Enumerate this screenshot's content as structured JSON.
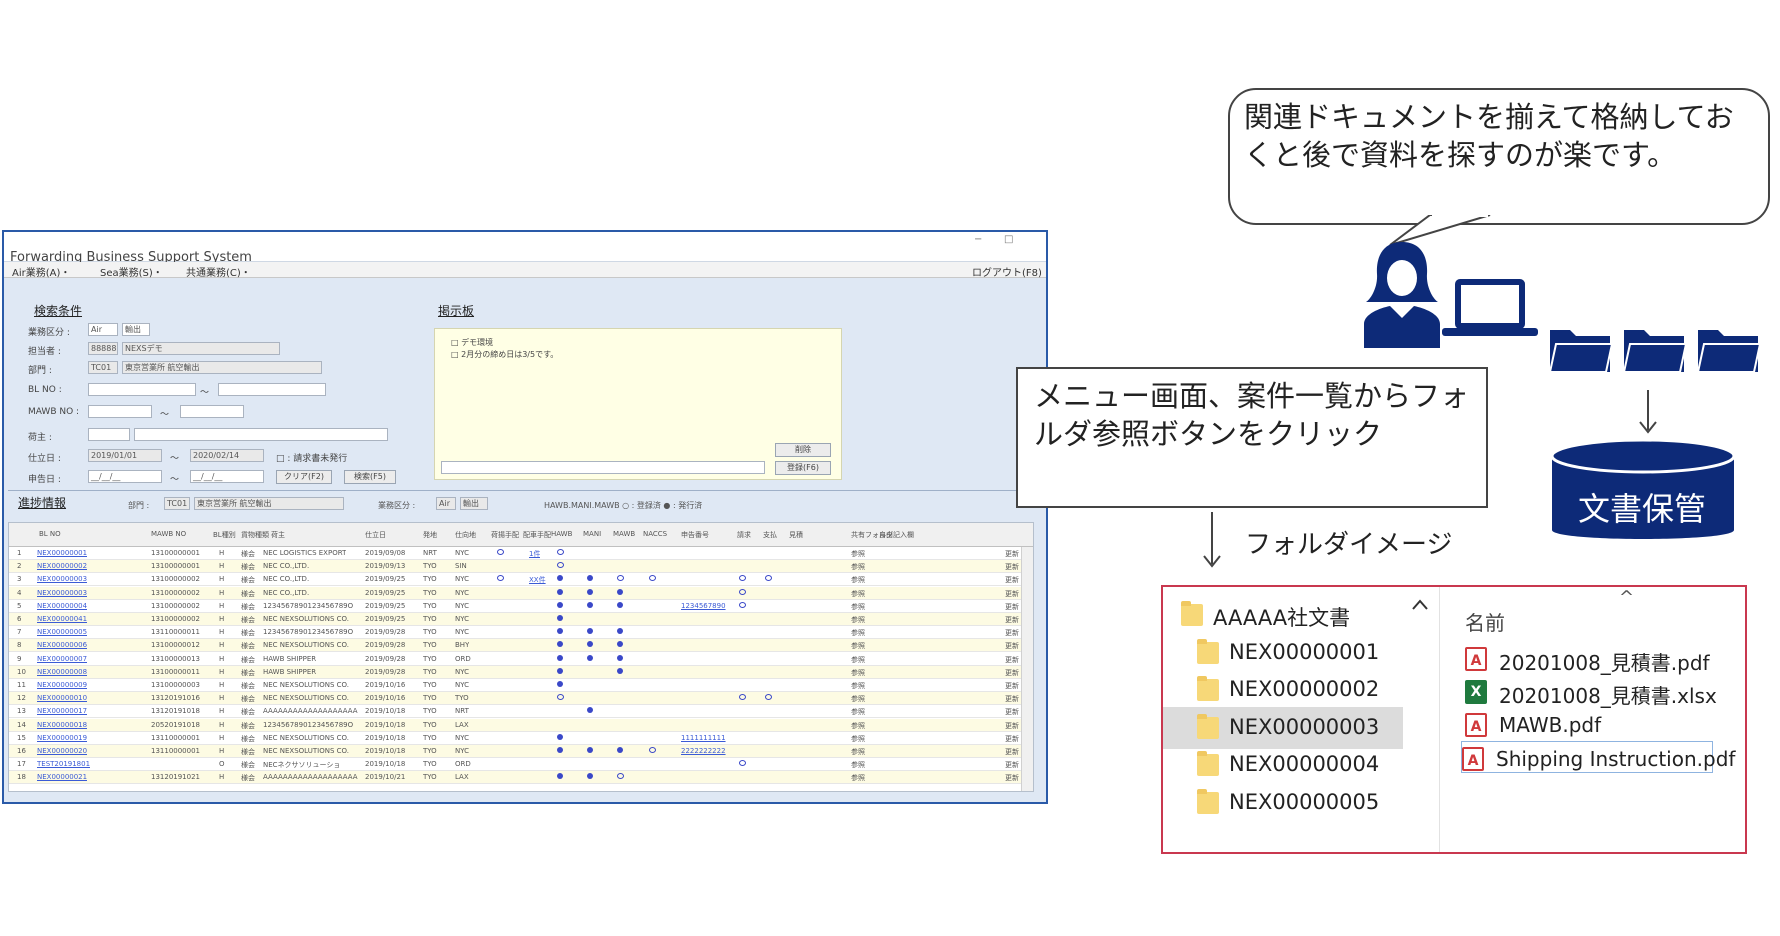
{
  "window": {
    "title": "Forwarding Business Support System",
    "controls": [
      "−",
      "□"
    ],
    "menu": [
      "Air業務(A)・",
      "Sea業務(S)・",
      "共通業務(C)・"
    ],
    "logout": "ログアウト(F8)"
  },
  "search": {
    "section_title": "検索条件",
    "labels": [
      "業務区分 :",
      "担当者  :",
      "部門   :",
      "BL NO  :",
      "MAWB NO :",
      "荷主   :",
      "仕立日  :",
      "申告日  :"
    ],
    "business_type": "Air",
    "business_sub": "輸出",
    "staff_code": "88888",
    "staff_name": "NEXSデモ",
    "dept_code": "TC01",
    "dept_name": "東京営業所 航空輸出",
    "date_from": "2019/01/01",
    "date_to": "2020/02/14",
    "unbilled_label": "□ : 請求書未発行",
    "blank_date": "__/__/__",
    "tilde": "～",
    "clear_button": "クリア(F2)",
    "search_button": "検索(F5)"
  },
  "board": {
    "section_title": "掲示板",
    "lines": [
      "□ デモ環境",
      "□ 2月分の締め日は3/5です。"
    ],
    "delete_button": "削除",
    "register_button": "登録(F6)"
  },
  "progress": {
    "section_title": "進捗情報",
    "dept_label": "部門 :",
    "dept_code": "TC01",
    "dept_name": "東京営業所 航空輸出",
    "biz_label": "業務区分 :",
    "biz_value": "Air",
    "biz_sub": "輸出",
    "legend": "HAWB.MANI.MAWB  ○ : 登録済  ● : 発行済"
  },
  "grid": {
    "headers": [
      "BL NO",
      "MAWB NO",
      "BL種別",
      "貨物種類",
      "荷主",
      "仕立日",
      "発地",
      "仕向地",
      "荷揚手配",
      "配車手配",
      "HAWB",
      "MANI",
      "MAWB",
      "NACCS",
      "申告番号",
      "請求",
      "支払",
      "見積",
      "共有フォルダ",
      "自由記入欄"
    ],
    "rows": [
      {
        "n": "1",
        "bl": "NEX00000001",
        "mawb": "13100000001",
        "k": "H",
        "t": "様会",
        "shipper": "NEC LOGISTICS EXPORT",
        "date": "2019/09/08",
        "from": "NRT",
        "to": "NYC",
        "c1": "ring",
        "c2": "1件",
        "hawb": "ring",
        "mani": "",
        "mawb2": "",
        "naccs": "",
        "decl": "",
        "bill": "",
        "pay": ""
      },
      {
        "n": "2",
        "bl": "NEX00000002",
        "mawb": "13100000001",
        "k": "H",
        "t": "様会",
        "shipper": "NEC CO.,LTD.",
        "date": "2019/09/13",
        "from": "TYO",
        "to": "SIN",
        "c1": "",
        "c2": "",
        "hawb": "ring",
        "mani": "",
        "mawb2": "",
        "naccs": "",
        "decl": "",
        "bill": "",
        "pay": ""
      },
      {
        "n": "3",
        "bl": "NEX00000003",
        "mawb": "13100000002",
        "k": "H",
        "t": "様会",
        "shipper": "NEC CO.,LTD.",
        "date": "2019/09/25",
        "from": "TYO",
        "to": "NYC",
        "c1": "ring",
        "c2": "XX件",
        "hawb": "dot",
        "mani": "dot",
        "mawb2": "ring",
        "naccs": "ring",
        "decl": "",
        "bill": "ring",
        "pay": "ring"
      },
      {
        "n": "4",
        "bl": "NEX00000003",
        "mawb": "13100000002",
        "k": "H",
        "t": "様会",
        "shipper": "NEC CO.,LTD.",
        "date": "2019/09/25",
        "from": "TYO",
        "to": "NYC",
        "c1": "",
        "c2": "",
        "hawb": "dot",
        "mani": "dot",
        "mawb2": "dot",
        "naccs": "",
        "decl": "",
        "bill": "ring",
        "pay": ""
      },
      {
        "n": "5",
        "bl": "NEX00000004",
        "mawb": "13100000002",
        "k": "H",
        "t": "様会",
        "shipper": "1234567890123456789O",
        "date": "2019/09/25",
        "from": "TYO",
        "to": "NYC",
        "c1": "",
        "c2": "",
        "hawb": "dot",
        "mani": "dot",
        "mawb2": "dot",
        "naccs": "",
        "decl": "1234567890",
        "bill": "ring",
        "pay": ""
      },
      {
        "n": "6",
        "bl": "NEX00000041",
        "mawb": "13100000002",
        "k": "H",
        "t": "様会",
        "shipper": "NEC NEXSOLUTIONS CO.",
        "date": "2019/09/25",
        "from": "TYO",
        "to": "NYC",
        "c1": "",
        "c2": "",
        "hawb": "dot",
        "mani": "",
        "mawb2": "",
        "naccs": "",
        "decl": "",
        "bill": "",
        "pay": ""
      },
      {
        "n": "7",
        "bl": "NEX00000005",
        "mawb": "13110000011",
        "k": "H",
        "t": "様会",
        "shipper": "1234567890123456789O",
        "date": "2019/09/28",
        "from": "TYO",
        "to": "NYC",
        "c1": "",
        "c2": "",
        "hawb": "dot",
        "mani": "dot",
        "mawb2": "dot",
        "naccs": "",
        "decl": "",
        "bill": "",
        "pay": ""
      },
      {
        "n": "8",
        "bl": "NEX00000006",
        "mawb": "13100000012",
        "k": "H",
        "t": "様会",
        "shipper": "NEC NEXSOLUTIONS CO.",
        "date": "2019/09/28",
        "from": "TYO",
        "to": "BHY",
        "c1": "",
        "c2": "",
        "hawb": "dot",
        "mani": "dot",
        "mawb2": "dot",
        "naccs": "",
        "decl": "",
        "bill": "",
        "pay": ""
      },
      {
        "n": "9",
        "bl": "NEX00000007",
        "mawb": "13100000013",
        "k": "H",
        "t": "様会",
        "shipper": "HAWB SHIPPER",
        "date": "2019/09/28",
        "from": "TYO",
        "to": "ORD",
        "c1": "",
        "c2": "",
        "hawb": "dot",
        "mani": "dot",
        "mawb2": "dot",
        "naccs": "",
        "decl": "",
        "bill": "",
        "pay": ""
      },
      {
        "n": "10",
        "bl": "NEX00000008",
        "mawb": "13100000011",
        "k": "H",
        "t": "様会",
        "shipper": "HAWB SHIPPER",
        "date": "2019/09/28",
        "from": "TYO",
        "to": "NYC",
        "c1": "",
        "c2": "",
        "hawb": "dot",
        "mani": "",
        "mawb2": "dot",
        "naccs": "",
        "decl": "",
        "bill": "",
        "pay": ""
      },
      {
        "n": "11",
        "bl": "NEX00000009",
        "mawb": "13100000003",
        "k": "H",
        "t": "様会",
        "shipper": "NEC NEXSOLUTIONS CO.",
        "date": "2019/10/16",
        "from": "TYO",
        "to": "NYC",
        "c1": "",
        "c2": "",
        "hawb": "dot",
        "mani": "",
        "mawb2": "",
        "naccs": "",
        "decl": "",
        "bill": "",
        "pay": ""
      },
      {
        "n": "12",
        "bl": "NEX00000010",
        "mawb": "13120191016",
        "k": "H",
        "t": "様会",
        "shipper": "NEC NEXSOLUTIONS CO.",
        "date": "2019/10/16",
        "from": "TYO",
        "to": "TYO",
        "c1": "",
        "c2": "",
        "hawb": "ring",
        "mani": "",
        "mawb2": "",
        "naccs": "",
        "decl": "",
        "bill": "ring",
        "pay": "ring"
      },
      {
        "n": "13",
        "bl": "NEX00000017",
        "mawb": "13120191018",
        "k": "H",
        "t": "様会",
        "shipper": "AAAAAAAAAAAAAAAAAAA",
        "date": "2019/10/18",
        "from": "TYO",
        "to": "NRT",
        "c1": "",
        "c2": "",
        "hawb": "",
        "mani": "dot",
        "mawb2": "",
        "naccs": "",
        "decl": "",
        "bill": "",
        "pay": ""
      },
      {
        "n": "14",
        "bl": "NEX00000018",
        "mawb": "20520191018",
        "k": "H",
        "t": "様会",
        "shipper": "1234567890123456789O",
        "date": "2019/10/18",
        "from": "TYO",
        "to": "LAX",
        "c1": "",
        "c2": "",
        "hawb": "",
        "mani": "",
        "mawb2": "",
        "naccs": "",
        "decl": "",
        "bill": "",
        "pay": ""
      },
      {
        "n": "15",
        "bl": "NEX00000019",
        "mawb": "13110000001",
        "k": "H",
        "t": "様会",
        "shipper": "NEC NEXSOLUTIONS CO.",
        "date": "2019/10/18",
        "from": "TYO",
        "to": "NYC",
        "c1": "",
        "c2": "",
        "hawb": "dot",
        "mani": "",
        "mawb2": "",
        "naccs": "",
        "decl": "1111111111",
        "bill": "",
        "pay": ""
      },
      {
        "n": "16",
        "bl": "NEX00000020",
        "mawb": "13110000001",
        "k": "H",
        "t": "様会",
        "shipper": "NEC NEXSOLUTIONS CO.",
        "date": "2019/10/18",
        "from": "TYO",
        "to": "NYC",
        "c1": "",
        "c2": "",
        "hawb": "dot",
        "mani": "dot",
        "mawb2": "dot",
        "naccs": "ring",
        "decl": "2222222222",
        "bill": "",
        "pay": ""
      },
      {
        "n": "17",
        "bl": "TEST20191801",
        "mawb": "",
        "k": "O",
        "t": "様会",
        "shipper": "NECネクサソリューショ",
        "date": "2019/10/18",
        "from": "TYO",
        "to": "ORD",
        "c1": "",
        "c2": "",
        "hawb": "",
        "mani": "",
        "mawb2": "",
        "naccs": "",
        "decl": "",
        "bill": "ring",
        "pay": ""
      },
      {
        "n": "18",
        "bl": "NEX00000021",
        "mawb": "13120191021",
        "k": "H",
        "t": "様会",
        "shipper": "AAAAAAAAAAAAAAAAAAA",
        "date": "2019/10/21",
        "from": "TYO",
        "to": "LAX",
        "c1": "",
        "c2": "",
        "hawb": "dot",
        "mani": "dot",
        "mawb2": "ring",
        "naccs": "",
        "decl": "",
        "bill": "",
        "pay": ""
      }
    ],
    "ref_label": "参照",
    "update_label": "更新"
  },
  "illustration": {
    "bubble_text": "関連ドキュメントを揃えて格納しておくと後で資料を探すのが楽です。",
    "callout_text": "メニュー画面、案件一覧からフォルダ参照ボタンをクリック",
    "storage_label": "文書保管",
    "folder_image_label": "フォルダイメージ",
    "accent_color": "#0d2a78"
  },
  "explorer": {
    "tree": [
      "AAAAA社文書",
      "NEX00000001",
      "NEX00000002",
      "NEX00000003",
      "NEX00000004",
      "NEX00000005"
    ],
    "selected": "NEX00000003",
    "column_header": "名前",
    "sort_glyph": "^",
    "files": [
      {
        "name": "20201008_見積書.pdf",
        "type": "pdf"
      },
      {
        "name": "20201008_見積書.xlsx",
        "type": "xlsx"
      },
      {
        "name": "MAWB.pdf",
        "type": "pdf"
      },
      {
        "name": "Shipping Instruction.pdf",
        "type": "pdf"
      }
    ]
  }
}
